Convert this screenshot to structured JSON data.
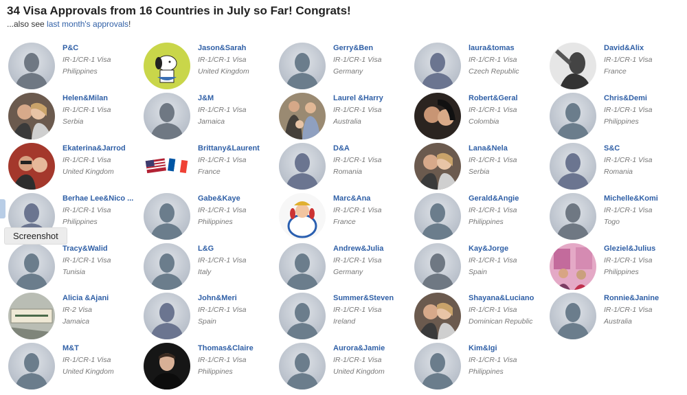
{
  "header": {
    "title": "34 Visa Approvals from 16 Countries in July so Far! Congrats!",
    "sub_prefix": "...also see ",
    "sub_link": "last month's approvals",
    "sub_suffix": "!"
  },
  "tooltip": "Screenshot",
  "cards": [
    {
      "name": "P&C",
      "visa": "IR-1/CR-1 Visa",
      "country": "Philippines",
      "avatar": "silhouette-gray"
    },
    {
      "name": "Jason&Sarah",
      "visa": "IR-1/CR-1 Visa",
      "country": "United Kingdom",
      "avatar": "cartoon-dog"
    },
    {
      "name": "Gerry&Ben",
      "visa": "IR-1/CR-1 Visa",
      "country": "Germany",
      "avatar": "silhouette-teal"
    },
    {
      "name": "laura&tomas",
      "visa": "IR-1/CR-1 Visa",
      "country": "Czech Republic",
      "avatar": "silhouette-blue"
    },
    {
      "name": "David&Alix",
      "visa": "IR-1/CR-1 Visa",
      "country": "France",
      "avatar": "photo-bw"
    },
    {
      "name": "Helen&Milan",
      "visa": "IR-1/CR-1 Visa",
      "country": "Serbia",
      "avatar": "photo-couple"
    },
    {
      "name": "J&M",
      "visa": "IR-1/CR-1 Visa",
      "country": "Jamaica",
      "avatar": "silhouette-gray"
    },
    {
      "name": "Laurel &Harry",
      "visa": "IR-1/CR-1 Visa",
      "country": "Australia",
      "avatar": "photo-family"
    },
    {
      "name": "Robert&Geral",
      "visa": "IR-1/CR-1 Visa",
      "country": "Colombia",
      "avatar": "photo-dark"
    },
    {
      "name": "Chris&Demi",
      "visa": "IR-1/CR-1 Visa",
      "country": "Philippines",
      "avatar": "silhouette-teal"
    },
    {
      "name": "Ekaterina&Jarrod",
      "visa": "IR-1/CR-1 Visa",
      "country": "United Kingdom",
      "avatar": "photo-red"
    },
    {
      "name": "Brittany&Laurent",
      "visa": "IR-1/CR-1 Visa",
      "country": "France",
      "avatar": "flags"
    },
    {
      "name": "D&A",
      "visa": "IR-1/CR-1 Visa",
      "country": "Romania",
      "avatar": "silhouette-blue"
    },
    {
      "name": "Lana&Nela",
      "visa": "IR-1/CR-1 Visa",
      "country": "Serbia",
      "avatar": "photo-couple"
    },
    {
      "name": "S&C",
      "visa": "IR-1/CR-1 Visa",
      "country": "Romania",
      "avatar": "silhouette-blue"
    },
    {
      "name": "Berhae Lee&Nico ...",
      "visa": "IR-1/CR-1 Visa",
      "country": "Philippines",
      "avatar": "silhouette-blue"
    },
    {
      "name": "Gabe&Kaye",
      "visa": "IR-1/CR-1 Visa",
      "country": "Philippines",
      "avatar": "silhouette-teal"
    },
    {
      "name": "Marc&Ana",
      "visa": "IR-1/CR-1 Visa",
      "country": "France",
      "avatar": "cartoon-obelix"
    },
    {
      "name": "Gerald&Angie",
      "visa": "IR-1/CR-1 Visa",
      "country": "Philippines",
      "avatar": "silhouette-teal"
    },
    {
      "name": "Michelle&Komi",
      "visa": "IR-1/CR-1 Visa",
      "country": "Togo",
      "avatar": "silhouette-gray"
    },
    {
      "name": "Tracy&Walid",
      "visa": "IR-1/CR-1 Visa",
      "country": "Tunisia",
      "avatar": "silhouette-teal"
    },
    {
      "name": "L&G",
      "visa": "IR-1/CR-1 Visa",
      "country": "Italy",
      "avatar": "silhouette-teal"
    },
    {
      "name": "Andrew&Julia",
      "visa": "IR-1/CR-1 Visa",
      "country": "Germany",
      "avatar": "silhouette-teal"
    },
    {
      "name": "Kay&Jorge",
      "visa": "IR-1/CR-1 Visa",
      "country": "Spain",
      "avatar": "silhouette-gray"
    },
    {
      "name": "Gleziel&Julius",
      "visa": "IR-1/CR-1 Visa",
      "country": "Philippines",
      "avatar": "photo-pink"
    },
    {
      "name": "Alicia &Ajani",
      "visa": "IR-2 Visa",
      "country": "Jamaica",
      "avatar": "photo-sign"
    },
    {
      "name": "John&Meri",
      "visa": "IR-1/CR-1 Visa",
      "country": "Spain",
      "avatar": "silhouette-blue"
    },
    {
      "name": "Summer&Steven",
      "visa": "IR-1/CR-1 Visa",
      "country": "Ireland",
      "avatar": "silhouette-teal"
    },
    {
      "name": "Shayana&Luciano",
      "visa": "IR-1/CR-1 Visa",
      "country": "Dominican Republic",
      "avatar": "photo-couple"
    },
    {
      "name": "Ronnie&Janine",
      "visa": "IR-1/CR-1 Visa",
      "country": "Australia",
      "avatar": "silhouette-teal"
    },
    {
      "name": "M&T",
      "visa": "IR-1/CR-1 Visa",
      "country": "United Kingdom",
      "avatar": "silhouette-teal"
    },
    {
      "name": "Thomas&Claire",
      "visa": "IR-1/CR-1 Visa",
      "country": "Philippines",
      "avatar": "photo-man"
    },
    {
      "name": "Aurora&Jamie",
      "visa": "IR-1/CR-1 Visa",
      "country": "United Kingdom",
      "avatar": "silhouette-teal"
    },
    {
      "name": "Kim&Igi",
      "visa": "IR-1/CR-1 Visa",
      "country": "Philippines",
      "avatar": "silhouette-teal"
    }
  ]
}
